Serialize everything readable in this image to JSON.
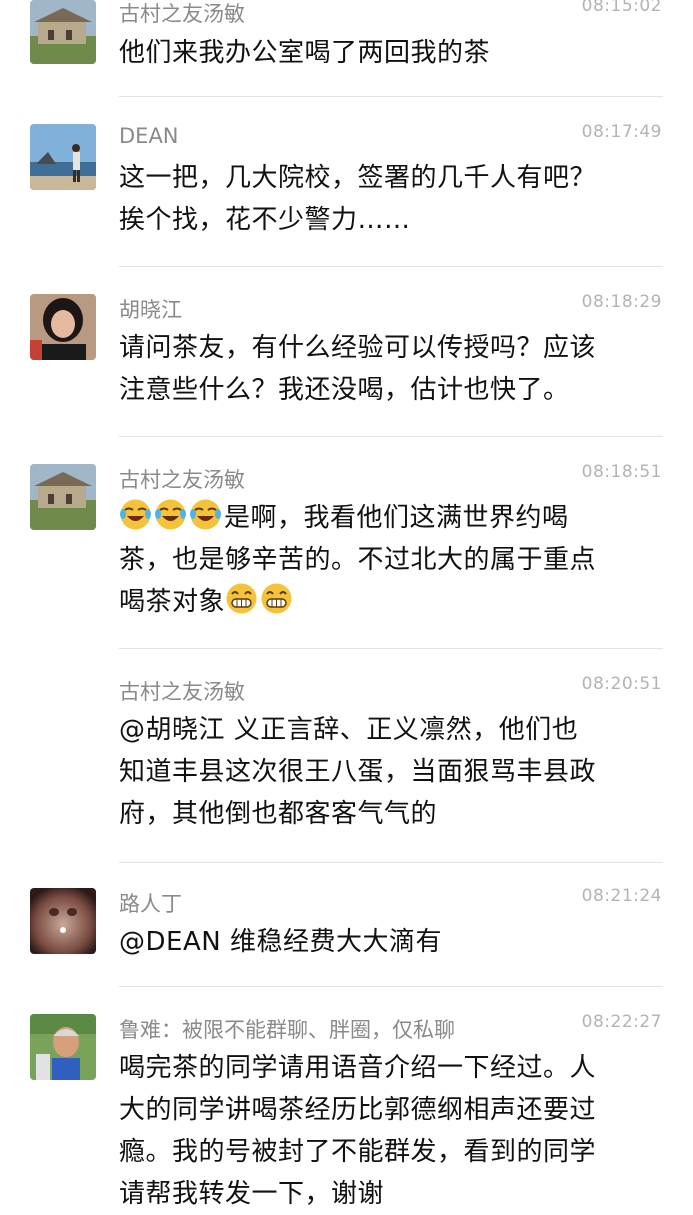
{
  "messages": [
    {
      "name": "古村之友汤敏",
      "time": "08:15:02",
      "lines": [
        "他们来我办公室喝了两回我的茶"
      ]
    },
    {
      "name": "DEAN",
      "time": "08:17:49",
      "lines": [
        "这一把，几大院校，签署的几千人有吧？",
        "挨个找，花不少警力……"
      ]
    },
    {
      "name": "胡晓江",
      "time": "08:18:29",
      "lines": [
        "请问茶友，有什么经验可以传授吗？应该",
        "注意些什么？我还没喝，估计也快了。"
      ]
    },
    {
      "name": "古村之友汤敏",
      "time": "08:18:51",
      "line1": "是啊，我看他们这满世界约喝",
      "line2": "茶，也是够辛苦的。不过北大的属于重点",
      "line3": "喝茶对象",
      "emoji_before": "crying-laughing-emoji",
      "emoji_after": "grinning-emoji"
    },
    {
      "name": "古村之友汤敏",
      "time": "08:20:51",
      "lines": [
        "@胡晓江 义正言辞、正义凛然，他们也",
        "知道丰县这次很王八蛋，当面狠骂丰县政",
        "府，其他倒也都客客气气的"
      ]
    },
    {
      "name": "路人丁",
      "time": "08:21:24",
      "lines": [
        "@DEAN 维稳经费大大滴有"
      ]
    },
    {
      "name": "鲁难：被限不能群聊、胖圈，仅私聊",
      "time": "08:22:27",
      "lines": [
        "喝完茶的同学请用语音介绍一下经过。人",
        "大的同学讲喝茶经历比郭德纲相声还要过",
        "瘾。我的号被封了不能群发，看到的同学",
        "请帮我转发一下，谢谢"
      ]
    }
  ]
}
